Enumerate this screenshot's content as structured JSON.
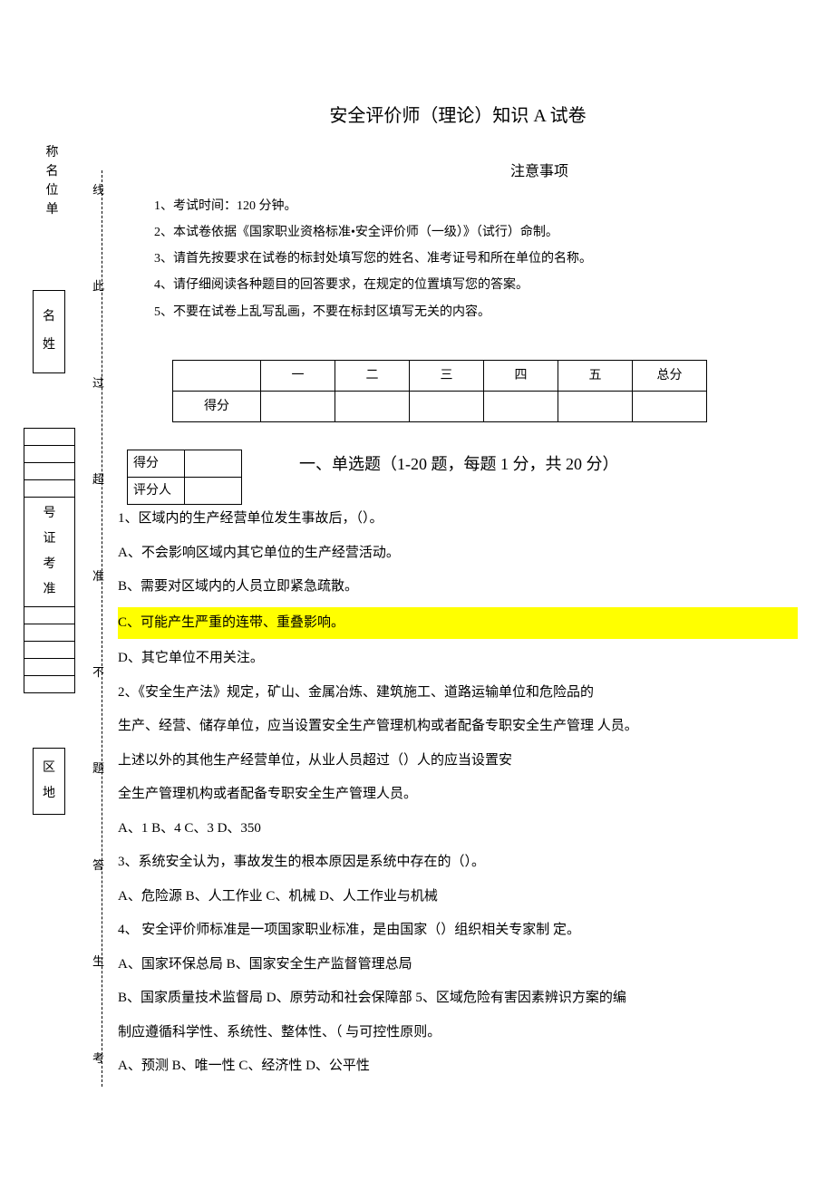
{
  "title": "安全评价师（理论）知识 A 试卷",
  "subtitle": "注意事项",
  "notes": {
    "n1": "1、考试时间：120 分钟。",
    "n2": "2、本试卷依据《国家职业资格标准•安全评价师（一级）》（试行）命制。",
    "n3": "3、请首先按要求在试卷的标封处填写您的姓名、准考证号和所在单位的名称。",
    "n4": "4、请仔细阅读各种题目的回答要求，在规定的位置填写您的答案。",
    "n5": "5、不要在试卷上乱写乱画，不要在标封区填写无关的内容。"
  },
  "score_table": {
    "row1": [
      "",
      "一",
      "二",
      "三",
      "四",
      "五",
      "总分"
    ],
    "row2_label": "得分"
  },
  "mini": {
    "r1": "得分",
    "r2": "评分人"
  },
  "section1_heading": "一、单选题（1-20 题，每题 1 分，共 20 分）",
  "q": {
    "q1_stem": "1、区域内的生产经营单位发生事故后，（）。",
    "q1_a": "A、不会影响区域内其它单位的生产经营活动。",
    "q1_b": "B、需要对区域内的人员立即紧急疏散。",
    "q1_c": "C、可能产生严重的连带、重叠影响。",
    "q1_d": "D、其它单位不用关注。",
    "q2_l1": "2、《安全生产法》规定，矿山、金属冶炼、建筑施工、道路运输单位和危险品的",
    "q2_l2": "生产、经营、储存单位，应当设置安全生产管理机构或者配备专职安全生产管理 人员。",
    "q2_l3": "上述以外的其他生产经营单位，从业人员超过（）人的应当设置安",
    "q2_l4": "全生产管理机构或者配备专职安全生产管理人员。",
    "q2_opts": "A、1 B、4 C、3 D、350",
    "q3_stem": "3、系统安全认为，事故发生的根本原因是系统中存在的（）。",
    "q3_opts": "A、危险源 B、人工作业 C、机械 D、人工作业与机械",
    "q4_stem": "4、 安全评价师标准是一项国家职业标准，是由国家（）组织相关专家制 定。",
    "q4_opts1": "A、国家环保总局 B、国家安全生产监督管理总局",
    "q4_opts2": "B、国家质量技术监督局 D、原劳动和社会保障部 5、区域危险有害因素辨识方案的编",
    "q5_l2": "制应遵循科学性、系统性、整体性、（ 与可控性原则。",
    "q5_opts": "A、预测 B、唯一性 C、经济性 D、公平性"
  },
  "leftcol": {
    "unit": [
      "称",
      "名",
      "位",
      "单"
    ],
    "name": [
      "名",
      "姓"
    ],
    "exam_id": [
      "号",
      "证",
      "考",
      "准"
    ],
    "region": [
      "区",
      "地"
    ]
  },
  "dashed_labels": [
    "线",
    "此",
    "过",
    "超",
    "准",
    "不",
    "题",
    "答",
    "生",
    "考"
  ]
}
